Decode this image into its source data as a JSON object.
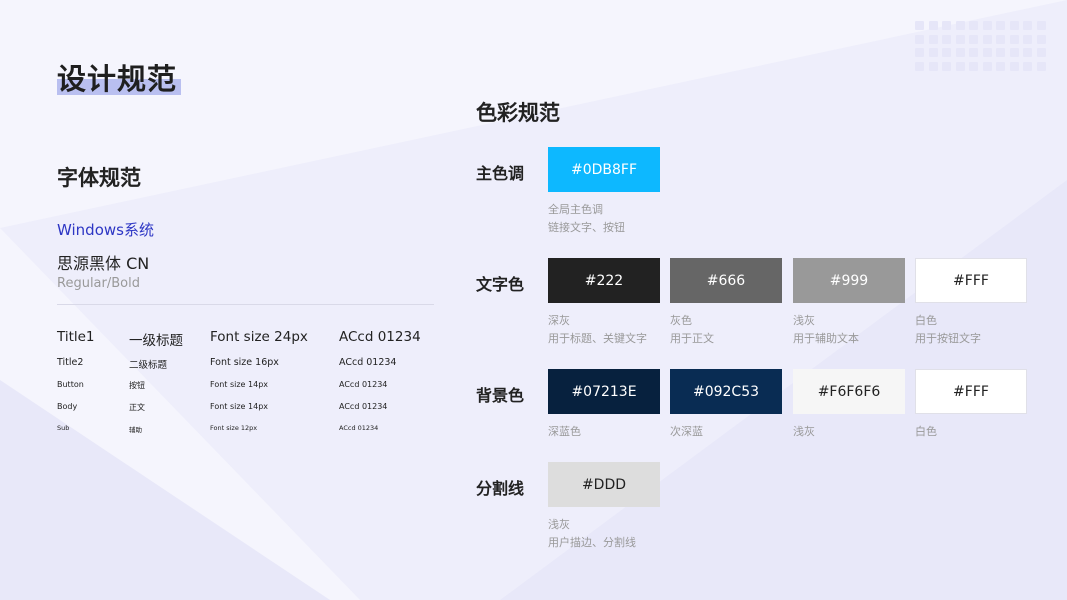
{
  "page": {
    "title": "设计规范"
  },
  "typography": {
    "section_title": "字体规范",
    "os": "Windows系统",
    "font_name": "思源黑体 CN",
    "weights": "Regular/Bold",
    "rows": [
      {
        "key": "title1",
        "name": "Title1",
        "zh": "一级标题",
        "size": "Font size 24px",
        "sample": "ACcd 01234"
      },
      {
        "key": "title2",
        "name": "Title2",
        "zh": "二级标题",
        "size": "Font size 16px",
        "sample": "ACcd 01234"
      },
      {
        "key": "button",
        "name": "Button",
        "zh": "按钮",
        "size": "Font size 14px",
        "sample": "ACcd 01234"
      },
      {
        "key": "body",
        "name": "Body",
        "zh": "正文",
        "size": "Font size 14px",
        "sample": "ACcd 01234"
      },
      {
        "key": "sub",
        "name": "Sub",
        "zh": "辅助",
        "size": "Font size 12px",
        "sample": "ACcd 01234"
      }
    ]
  },
  "colors": {
    "section_title": "色彩规范",
    "primary": {
      "label": "主色调",
      "swatches": [
        {
          "hex": "#0DB8FF",
          "color": "#0DB8FF",
          "text_color": "#FFFFFF",
          "desc": [
            "全局主色调",
            "链接文字、按钮"
          ]
        }
      ]
    },
    "text": {
      "label": "文字色",
      "swatches": [
        {
          "hex": "#222",
          "color": "#222222",
          "text_color": "#FFFFFF",
          "desc": [
            "深灰",
            "用于标题、关键文字"
          ]
        },
        {
          "hex": "#666",
          "color": "#666666",
          "text_color": "#FFFFFF",
          "desc": [
            "灰色",
            "用于正文"
          ]
        },
        {
          "hex": "#999",
          "color": "#999999",
          "text_color": "#FFFFFF",
          "desc": [
            "浅灰",
            "用于辅助文本"
          ]
        },
        {
          "hex": "#FFF",
          "color": "#FFFFFF",
          "text_color": "#222222",
          "desc": [
            "白色",
            "用于按钮文字"
          ]
        }
      ]
    },
    "background": {
      "label": "背景色",
      "swatches": [
        {
          "hex": "#07213E",
          "color": "#07213E",
          "text_color": "#FFFFFF",
          "desc": [
            "深蓝色"
          ]
        },
        {
          "hex": "#092C53",
          "color": "#092C53",
          "text_color": "#FFFFFF",
          "desc": [
            "次深蓝"
          ]
        },
        {
          "hex": "#F6F6F6",
          "color": "#F6F6F6",
          "text_color": "#222222",
          "desc": [
            "浅灰"
          ]
        },
        {
          "hex": "#FFF",
          "color": "#FFFFFF",
          "text_color": "#222222",
          "desc": [
            "白色"
          ]
        }
      ]
    },
    "divider": {
      "label": "分割线",
      "swatches": [
        {
          "hex": "#DDD",
          "color": "#DDDDDD",
          "text_color": "#222222",
          "desc": [
            "浅灰",
            "用户描边、分割线"
          ]
        }
      ]
    }
  }
}
